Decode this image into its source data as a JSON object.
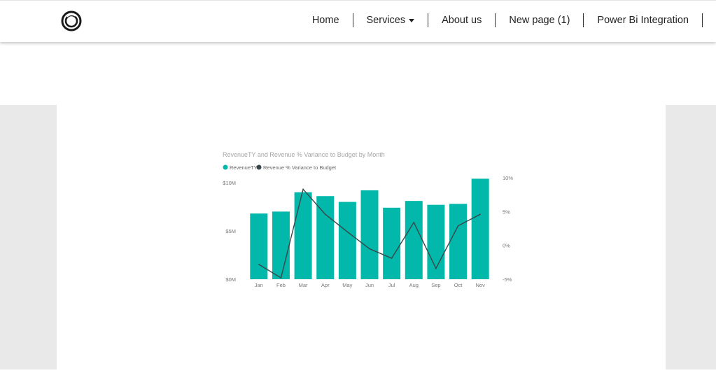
{
  "nav": {
    "items": [
      {
        "label": "Home"
      },
      {
        "label": "Services",
        "dropdown": true
      },
      {
        "label": "About us"
      },
      {
        "label": "New page (1)"
      },
      {
        "label": "Power Bi Integration"
      }
    ]
  },
  "logo_icon": "ring-logo-icon",
  "colors": {
    "bar": "#01b8aa",
    "line": "#374649",
    "canvas": "#e9e9e9"
  },
  "chart_data": {
    "type": "bar",
    "title": "RevenueTY and Revenue % Variance to Budget by Month",
    "categories": [
      "Jan",
      "Feb",
      "Mar",
      "Apr",
      "May",
      "Jun",
      "Jul",
      "Aug",
      "Sep",
      "Oct",
      "Nov"
    ],
    "series": [
      {
        "name": "RevenueTY",
        "type": "bar",
        "axis": "left",
        "color": "#01b8aa",
        "values": [
          6.8,
          7.0,
          9.0,
          8.6,
          8.0,
          9.2,
          7.4,
          8.1,
          7.7,
          7.8,
          10.4
        ]
      },
      {
        "name": "Revenue % Variance to Budget",
        "type": "line",
        "axis": "right",
        "color": "#374649",
        "values": [
          -2.8,
          -4.8,
          8.3,
          4.6,
          2.0,
          -0.5,
          -1.9,
          3.4,
          -3.4,
          2.9,
          4.6
        ]
      }
    ],
    "y_left": {
      "ticks": [
        "$0M",
        "$5M",
        "$10M"
      ],
      "tick_values": [
        0,
        5,
        10
      ],
      "range": [
        0,
        10.5
      ]
    },
    "y_right": {
      "ticks": [
        "-5%",
        "0%",
        "5%",
        "10%"
      ],
      "tick_values": [
        -5,
        0,
        5,
        10
      ],
      "range": [
        -5,
        10
      ]
    },
    "legend_position": "top-left",
    "grid": false
  }
}
